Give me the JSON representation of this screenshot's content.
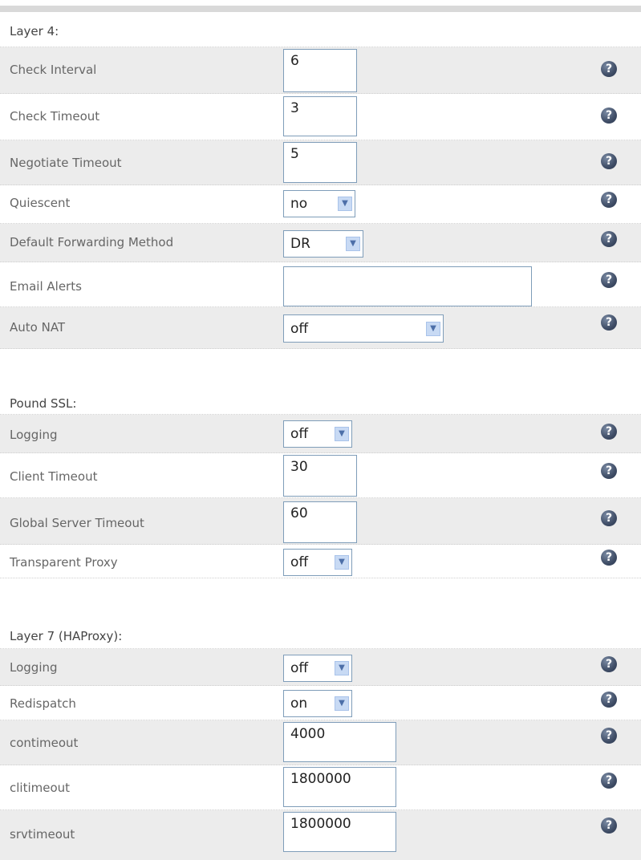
{
  "sections": [
    {
      "title": "Layer 4:",
      "rows": [
        {
          "label": "Check Interval",
          "type": "text",
          "value": "6"
        },
        {
          "label": "Check Timeout",
          "type": "text",
          "value": "3"
        },
        {
          "label": "Negotiate Timeout",
          "type": "text",
          "value": "5"
        },
        {
          "label": "Quiescent",
          "type": "select",
          "value": "no"
        },
        {
          "label": "Default Forwarding Method",
          "type": "select",
          "value": "DR"
        },
        {
          "label": "Email Alerts",
          "type": "text",
          "value": ""
        },
        {
          "label": "Auto NAT",
          "type": "select",
          "value": "off"
        }
      ]
    },
    {
      "title": "Pound SSL:",
      "rows": [
        {
          "label": "Logging",
          "type": "select",
          "value": "off"
        },
        {
          "label": "Client Timeout",
          "type": "text",
          "value": "30"
        },
        {
          "label": "Global Server Timeout",
          "type": "text",
          "value": "60"
        },
        {
          "label": "Transparent Proxy",
          "type": "select",
          "value": "off"
        }
      ]
    },
    {
      "title": "Layer 7 (HAProxy):",
      "rows": [
        {
          "label": "Logging",
          "type": "select",
          "value": "off"
        },
        {
          "label": "Redispatch",
          "type": "select",
          "value": "on"
        },
        {
          "label": "contimeout",
          "type": "text",
          "value": "4000"
        },
        {
          "label": "clitimeout",
          "type": "text",
          "value": "1800000"
        },
        {
          "label": "srvtimeout",
          "type": "text",
          "value": "1800000"
        }
      ]
    }
  ],
  "help_icon": {
    "glyph": "?",
    "name": "help-icon"
  },
  "dropdown_arrow": {
    "glyph": "▼"
  },
  "colors": {
    "row_shade": "#ececec",
    "input_border": "#7f9db9",
    "help_icon": "#3f4d66"
  }
}
